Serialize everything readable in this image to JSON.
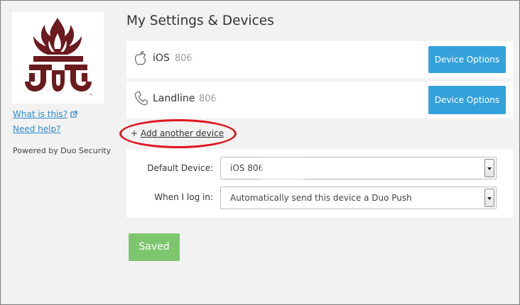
{
  "page_title": "My Settings & Devices",
  "sidebar": {
    "logo_tm": "™",
    "what_is_this": "What is this?",
    "need_help": "Need help?",
    "powered_by": "Powered by Duo Security"
  },
  "devices": [
    {
      "icon": "apple-icon",
      "name": "iOS",
      "number": "806-",
      "options_label": "Device Options"
    },
    {
      "icon": "phone-icon",
      "name": "Landline",
      "number": "806-",
      "options_label": "Device Options"
    }
  ],
  "add_device": {
    "prefix": "+",
    "label": "Add another device"
  },
  "settings": {
    "default_device_label": "Default Device:",
    "default_device_value": "iOS 806-",
    "when_login_label": "When I log in:",
    "when_login_value": "Automatically send this device a Duo Push"
  },
  "save_button": {
    "label": "Saved"
  },
  "colors": {
    "accent_blue": "#35a1db",
    "saved_green": "#7ec66e",
    "annotation_red": "#e0141e",
    "logo_maroon": "#6b1a1e"
  }
}
